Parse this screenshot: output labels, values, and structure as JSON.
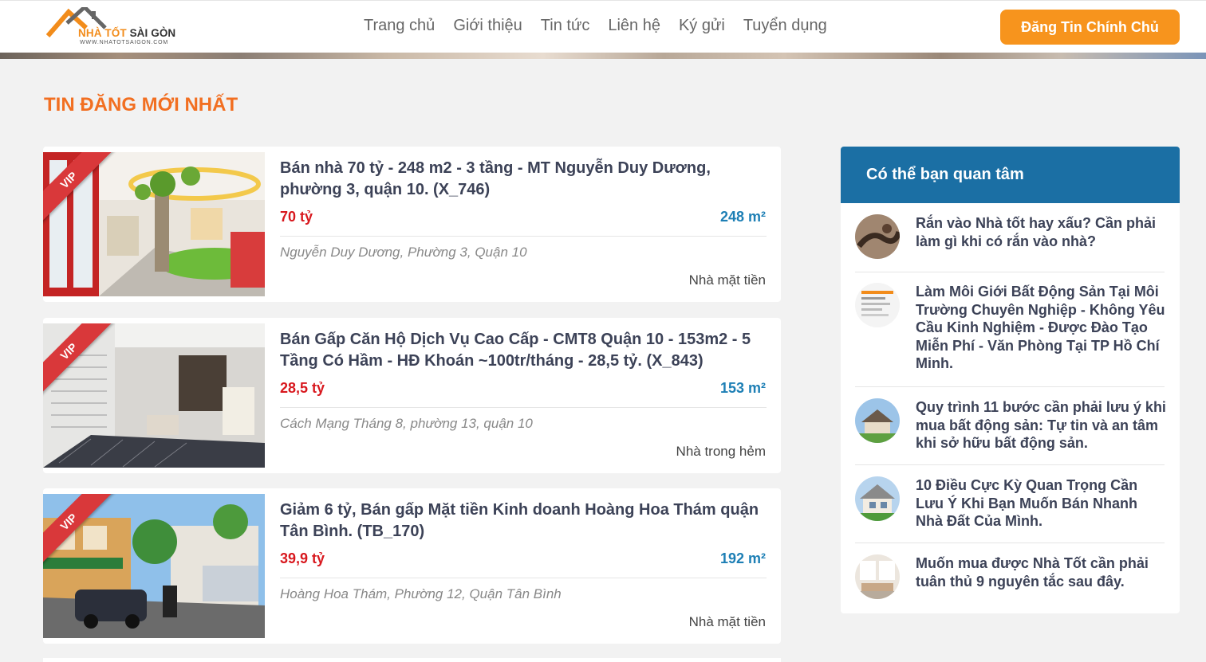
{
  "header": {
    "logo": {
      "name_part1": "NHÀ TỐT",
      "name_part2": "SÀI GÒN",
      "domain": "WWW.NHATOTSAIGON.COM"
    },
    "nav": [
      "Trang chủ",
      "Giới thiệu",
      "Tin tức",
      "Liên hệ",
      "Ký gửi",
      "Tuyển dụng"
    ],
    "cta_label": "Đăng Tin Chính Chủ"
  },
  "section_title": "TIN ĐĂNG MỚI NHẤT",
  "listings": [
    {
      "badge": "VIP",
      "title": "Bán nhà 70 tỷ - 248 m2 - 3 tầng - MT Nguyễn Duy Dương, phường 3, quận 10. (X_746)",
      "price": "70 tỷ",
      "area": "248 m²",
      "address": "Nguyễn Duy Dương, Phường 3, Quận 10",
      "type": "Nhà mặt tiền"
    },
    {
      "badge": "VIP",
      "title": "Bán Gấp Căn Hộ Dịch Vụ Cao Cấp - CMT8 Quận 10 - 153m2 - 5 Tầng Có Hầm - HĐ Khoán ~100tr/tháng - 28,5 tỷ. (X_843)",
      "price": "28,5 tỷ",
      "area": "153 m²",
      "address": "Cách Mạng Tháng 8, phường 13, quận 10",
      "type": "Nhà trong hẻm"
    },
    {
      "badge": "VIP",
      "title": "Giảm 6 tỷ, Bán gấp Mặt tiền Kinh doanh Hoàng Hoa Thám quận Tân Bình. (TB_170)",
      "price": "39,9 tỷ",
      "area": "192 m²",
      "address": "Hoàng Hoa Thám, Phường 12, Quận Tân Bình",
      "type": "Nhà mặt tiền"
    }
  ],
  "sidebar": {
    "title": "Có thể bạn quan tâm",
    "items": [
      {
        "text": "Rắn vào Nhà tốt hay xấu? Cần phải làm gì khi có rắn vào nhà?"
      },
      {
        "text": "Làm Môi Giới Bất Động Sản Tại Môi Trường Chuyên Nghiệp - Không Yêu Cầu Kinh Nghiệm - Được Đào Tạo Miễn Phí - Văn Phòng Tại TP Hồ Chí Minh."
      },
      {
        "text": "Quy trình 11 bước cần phải lưu ý khi mua bất động sản: Tự tin và an tâm khi sở hữu bất động sản."
      },
      {
        "text": "10 Điều Cực Kỳ Quan Trọng Cần Lưu Ý Khi Bạn Muốn Bán Nhanh Nhà Đất Của Mình."
      },
      {
        "text": "Muốn mua được Nhà Tốt cần phải tuân thủ 9 nguyên tắc sau đây."
      }
    ]
  },
  "colors": {
    "accent": "#f7941d",
    "title_orange": "#f26f21",
    "price_red": "#d8181e",
    "area_blue": "#1d7fb5",
    "sidebar_head": "#1b6fa4"
  }
}
